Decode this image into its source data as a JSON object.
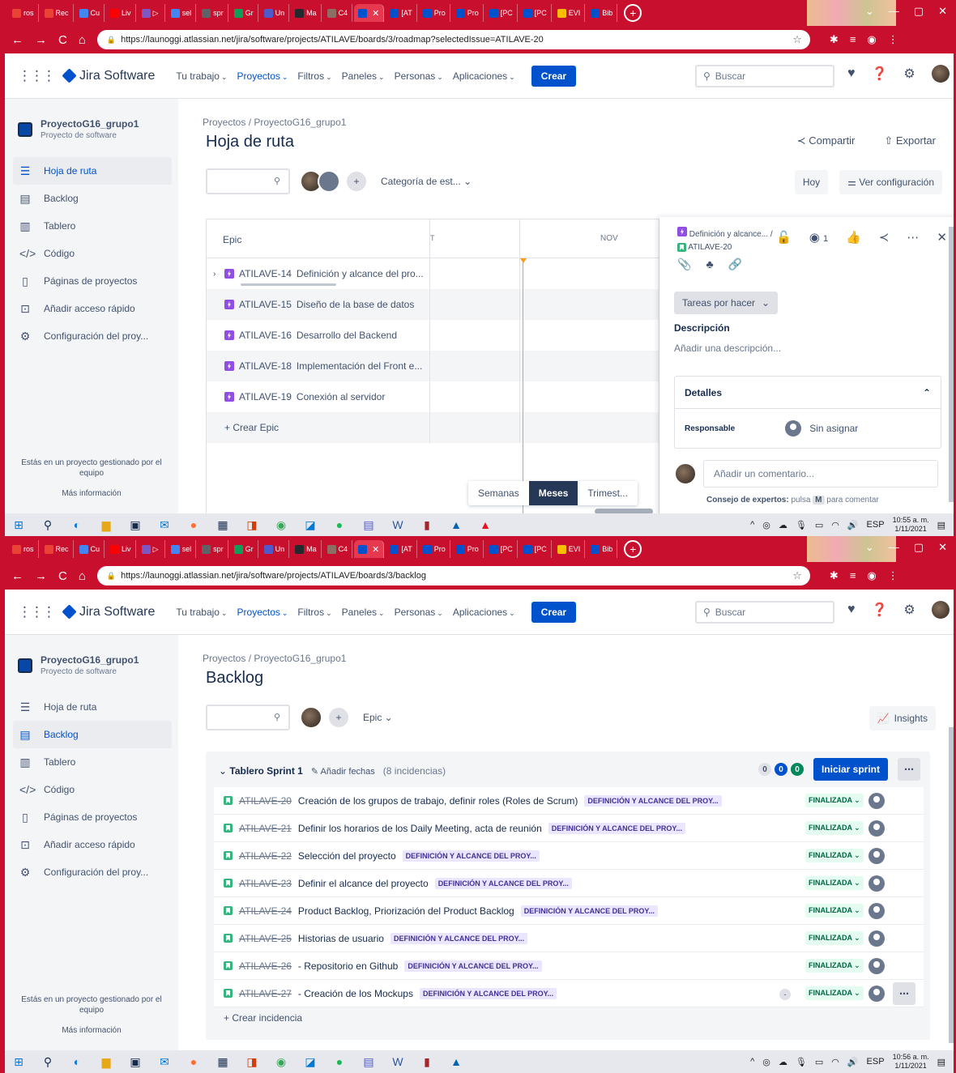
{
  "browser": {
    "tabs": [
      {
        "label": "ros",
        "color": "#ea4335"
      },
      {
        "label": "Rec",
        "color": "#ea4335"
      },
      {
        "label": "Cu",
        "color": "#4285f4"
      },
      {
        "label": "Liv",
        "color": "#ff0000"
      },
      {
        "label": "▷",
        "color": "#7e57c2"
      },
      {
        "label": "sel",
        "color": "#4285f4"
      },
      {
        "label": "spr",
        "color": "#5f6368"
      },
      {
        "label": "Gr",
        "color": "#0f9d58"
      },
      {
        "label": "Un",
        "color": "#5059c9"
      },
      {
        "label": "Ma",
        "color": "#24292e"
      },
      {
        "label": "C4",
        "color": "#8d6e63"
      },
      {
        "label": "",
        "color": "#0052cc",
        "active": true
      },
      {
        "label": "[AT",
        "color": "#0052cc"
      },
      {
        "label": "Pro",
        "color": "#0052cc"
      },
      {
        "label": "Pro",
        "color": "#0052cc"
      },
      {
        "label": "[PC",
        "color": "#0052cc"
      },
      {
        "label": "[PC",
        "color": "#0052cc"
      },
      {
        "label": "EVI",
        "color": "#fbbc04"
      },
      {
        "label": "Bib",
        "color": "#0052cc"
      }
    ],
    "window_controls": [
      "⌄",
      "—",
      "▢",
      "✕"
    ]
  },
  "shot1": {
    "url": "https://launoggi.atlassian.net/jira/software/projects/ATILAVE/boards/3/roadmap?selectedIssue=ATILAVE-20",
    "breadcrumb": "Proyectos  /  ProyectoG16_grupo1",
    "title": "Hoja de ruta",
    "share": "Compartir",
    "export": "Exportar",
    "category_filter": "Categoría de est...",
    "today": "Hoy",
    "view_settings": "Ver configuración",
    "col_epic": "Epic",
    "month_t": "T",
    "month_nov": "NOV",
    "epics": [
      {
        "key": "ATILAVE-14",
        "summary": "Definición y alcance del pro...",
        "expandable": true
      },
      {
        "key": "ATILAVE-15",
        "summary": "Diseño de la base de datos"
      },
      {
        "key": "ATILAVE-16",
        "summary": "Desarrollo del Backend"
      },
      {
        "key": "ATILAVE-18",
        "summary": "Implementación del Front e..."
      },
      {
        "key": "ATILAVE-19",
        "summary": "Conexión al servidor"
      }
    ],
    "create_epic": "+ Crear Epic",
    "timescale": [
      "Semanas",
      "Meses",
      "Trimest..."
    ],
    "timescale_selected": "Meses",
    "panel": {
      "parent": "Definición y alcance...",
      "parent_sep": "/",
      "issue_key": "ATILAVE-20",
      "watchers": "1",
      "status": "Tareas por hacer",
      "description_heading": "Descripción",
      "description_placeholder": "Añadir una descripción...",
      "details_heading": "Detalles",
      "assignee_label": "Responsable",
      "assignee_value": "Sin asignar",
      "comment_placeholder": "Añadir un comentario...",
      "tip_bold": "Consejo de expertos:",
      "tip_mid": "pulsa",
      "tip_key": "M",
      "tip_end": "para comentar"
    },
    "clock_time": "10:55 a. m.",
    "clock_date": "1/11/2021"
  },
  "shot2": {
    "url": "https://launoggi.atlassian.net/jira/software/projects/ATILAVE/boards/3/backlog",
    "breadcrumb": "Proyectos  /  ProyectoG16_grupo1",
    "title": "Backlog",
    "epic_filter": "Epic",
    "insights": "Insights",
    "sprint": {
      "name": "Tablero Sprint 1",
      "add_dates": "Añadir fechas",
      "count": "(8 incidencias)",
      "todo": "0",
      "in_progress": "0",
      "done": "0",
      "start": "Iniciar sprint"
    },
    "issues": [
      {
        "key": "ATILAVE-20",
        "summary": "Creación de los grupos de trabajo, definir roles (Roles de Scrum)",
        "epic": "DEFINICIÓN Y ALCANCE DEL PROY...",
        "status": "FINALIZADA"
      },
      {
        "key": "ATILAVE-21",
        "summary": "Definir los horarios de los Daily Meeting, acta de reunión",
        "epic": "DEFINICIÓN Y ALCANCE DEL PROY...",
        "status": "FINALIZADA"
      },
      {
        "key": "ATILAVE-22",
        "summary": "Selección del proyecto",
        "epic": "DEFINICIÓN Y ALCANCE DEL PROY...",
        "status": "FINALIZADA"
      },
      {
        "key": "ATILAVE-23",
        "summary": "Definir el alcance del proyecto",
        "epic": "DEFINICIÓN Y ALCANCE DEL PROY...",
        "status": "FINALIZADA"
      },
      {
        "key": "ATILAVE-24",
        "summary": "Product Backlog, Priorización del Product Backlog",
        "epic": "DEFINICIÓN Y ALCANCE DEL PROY...",
        "status": "FINALIZADA"
      },
      {
        "key": "ATILAVE-25",
        "summary": "Historias de usuario",
        "epic": "DEFINICIÓN Y ALCANCE DEL PROY...",
        "status": "FINALIZADA"
      },
      {
        "key": "ATILAVE-26",
        "summary": "- Repositorio en Github",
        "epic": "DEFINICIÓN Y ALCANCE DEL PROY...",
        "status": "FINALIZADA"
      },
      {
        "key": "ATILAVE-27",
        "summary": "- Creación de los Mockups",
        "epic": "DEFINICIÓN Y ALCANCE DEL PROY...",
        "status": "FINALIZADA",
        "estimate": "-",
        "hovered": true
      }
    ],
    "create_issue": "+ Crear incidencia",
    "clock_time": "10:56 a. m.",
    "clock_date": "1/11/2021"
  },
  "jira": {
    "product": "Jira Software",
    "nav": [
      "Tu trabajo",
      "Proyectos",
      "Filtros",
      "Paneles",
      "Personas",
      "Aplicaciones"
    ],
    "nav_selected": "Proyectos",
    "create": "Crear",
    "search_placeholder": "Buscar"
  },
  "sidebar": {
    "project_name": "ProyectoG16_grupo1",
    "project_type": "Proyecto de software",
    "items": [
      {
        "label": "Hoja de ruta",
        "icon": "roadmap-icon"
      },
      {
        "label": "Backlog",
        "icon": "backlog-icon"
      },
      {
        "label": "Tablero",
        "icon": "board-icon"
      },
      {
        "label": "Código",
        "icon": "code-icon"
      },
      {
        "label": "Páginas de proyectos",
        "icon": "pages-icon"
      },
      {
        "label": "Añadir acceso rápido",
        "icon": "add-shortcut-icon"
      },
      {
        "label": "Configuración del proy...",
        "icon": "settings-icon"
      }
    ],
    "footer": "Estás en un proyecto gestionado por el equipo",
    "more_info": "Más información"
  },
  "tray_lang": "ESP",
  "colors": {
    "chrome_red": "#c8102e",
    "jira_blue": "#0052cc",
    "epic_purple": "#904ee2",
    "story_green": "#36b37e",
    "today_orange": "#ff991f"
  }
}
